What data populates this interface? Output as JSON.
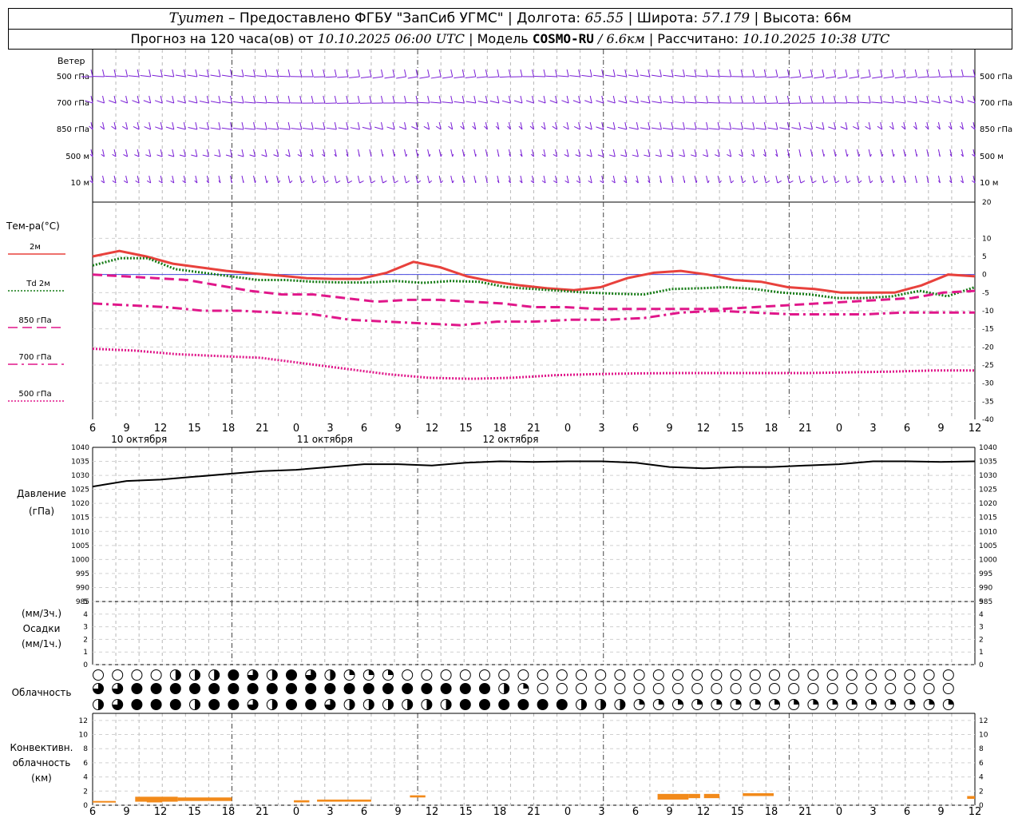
{
  "header": {
    "station": "Tyumen",
    "provided_by": "– Предоставлено ФГБУ \"ЗапСиб УГМС\" |",
    "lon_label": "Долгота:",
    "lon": "65.55",
    "lat_label": "| Широта:",
    "lat": "57.179",
    "alt_label": "| Высота:",
    "alt": "66м",
    "forecast_label": "Прогноз на 120 часа(ов) от",
    "forecast_start": "10.10.2025 06:00 UTC",
    "model_label": "| Модель",
    "model": "COSMO-RU",
    "resolution": "/ 6.6км",
    "computed_label": "| Рассчитано:",
    "computed": "10.10.2025 10:38 UTC"
  },
  "wind_panel": {
    "title": "Ветер",
    "levels": [
      "500 гПа",
      "700 гПа",
      "850 гПа",
      "500 м",
      "10 м"
    ],
    "color": "#7a1fd6"
  },
  "temp_panel": {
    "ylabel": "Тем-ра(°C)",
    "legend": [
      {
        "label": "2м",
        "color": "#e8413c",
        "style": "solid"
      },
      {
        "label": "Td  2м",
        "color": "#137a13",
        "style": "dotted"
      },
      {
        "label": "850 гПа",
        "color": "#e0178a",
        "style": "dash"
      },
      {
        "label": "700 гПа",
        "color": "#e0178a",
        "style": "dashdot"
      },
      {
        "label": "500 гПа",
        "color": "#e0178a",
        "style": "dotted"
      }
    ]
  },
  "pressure_panel": {
    "ylabel": [
      "Давление",
      "(гПа)"
    ]
  },
  "precip_panel": {
    "ylabel": [
      "(мм/3ч.)",
      "Осадки",
      "(мм/1ч.)"
    ]
  },
  "cloud_panel": {
    "ylabel": "Облачность"
  },
  "conv_panel": {
    "ylabel": [
      "Конвективн.",
      "облачность",
      "(км)"
    ]
  },
  "time_axis": {
    "ticks": [
      "6",
      "9",
      "12",
      "15",
      "18",
      "21",
      "0",
      "3",
      "6",
      "9",
      "12",
      "15",
      "18",
      "21",
      "0",
      "3",
      "6",
      "9",
      "12",
      "15",
      "18",
      "21",
      "0",
      "3",
      "6",
      "9",
      "12"
    ],
    "dates": [
      "10 октября",
      "11 октября",
      "12 октября"
    ]
  },
  "chart_data": [
    {
      "type": "line",
      "title": "Тем-ра(°C)",
      "x_hours": [
        0,
        3,
        6,
        9,
        12,
        15,
        18,
        21,
        24,
        27,
        30,
        33,
        36,
        39,
        42,
        45,
        48,
        51,
        54,
        57,
        60,
        63,
        66,
        69,
        72,
        75,
        78
      ],
      "ylim": [
        -40,
        20
      ],
      "yticks": [
        -40,
        -35,
        -30,
        -25,
        -20,
        -15,
        -10,
        -5,
        0,
        5,
        10
      ],
      "series": [
        {
          "name": "2м",
          "color": "#e8413c",
          "style": "solid",
          "values": [
            5,
            6.5,
            5,
            3,
            2,
            1,
            0.3,
            -0.3,
            -1,
            -1.2,
            -1.2,
            0.5,
            3.5,
            2,
            -0.5,
            -2,
            -3,
            -3.8,
            -4.3,
            -3.5,
            -1,
            0.5,
            1,
            0,
            -1.5,
            -2,
            -3.5,
            -4,
            -5,
            -5,
            -5,
            -3,
            0,
            -0.5
          ]
        },
        {
          "name": "Td 2м",
          "color": "#137a13",
          "style": "dotted",
          "values": [
            2.5,
            4.5,
            4.5,
            1.5,
            0.5,
            -0.5,
            -1.5,
            -1.5,
            -2,
            -2.2,
            -2.2,
            -1.8,
            -2.3,
            -1.8,
            -2,
            -3.5,
            -4,
            -4.5,
            -5,
            -5.3,
            -5.5,
            -4,
            -3.8,
            -3.5,
            -4,
            -5,
            -5.5,
            -6.5,
            -6.5,
            -6,
            -4.5,
            -6,
            -3.5
          ]
        },
        {
          "name": "850 гПа",
          "color": "#e0178a",
          "style": "dash",
          "values": [
            0,
            -0.5,
            -1,
            -1.5,
            -3,
            -4.5,
            -5.5,
            -5.5,
            -6.5,
            -7.5,
            -7,
            -7,
            -7.5,
            -8,
            -9,
            -9,
            -9.5,
            -9.5,
            -9.5,
            -9.5,
            -9.5,
            -9,
            -8.5,
            -8,
            -7.5,
            -7,
            -6.5,
            -5,
            -4.5
          ]
        },
        {
          "name": "700 гПа",
          "color": "#e0178a",
          "style": "dashdot",
          "values": [
            -8,
            -8.5,
            -9,
            -10,
            -10,
            -10.5,
            -11,
            -12.5,
            -13,
            -13.5,
            -14,
            -13,
            -13,
            -12.5,
            -12.5,
            -12,
            -10.5,
            -10,
            -10.5,
            -11,
            -11,
            -11,
            -10.5,
            -10.5,
            -10.5
          ]
        },
        {
          "name": "500 гПа",
          "color": "#e0178a",
          "style": "dotted",
          "values": [
            -20.5,
            -21,
            -22,
            -22.5,
            -23,
            -24.5,
            -26,
            -27.5,
            -28.5,
            -28.8,
            -28.5,
            -27.8,
            -27.5,
            -27.3,
            -27.2,
            -27.2,
            -27.2,
            -27.2,
            -27,
            -26.8,
            -26.5,
            -26.5
          ]
        }
      ]
    },
    {
      "type": "line",
      "title": "Давление (гПа)",
      "ylim": [
        985,
        1040
      ],
      "yticks": [
        985,
        990,
        995,
        1000,
        1005,
        1010,
        1015,
        1020,
        1025,
        1030,
        1035,
        1040
      ],
      "series": [
        {
          "name": "",
          "color": "#000000",
          "style": "solid",
          "values": [
            1026,
            1028,
            1028.5,
            1029.5,
            1030.5,
            1031.5,
            1032,
            1033,
            1034,
            1034,
            1033.5,
            1034.5,
            1035,
            1034.8,
            1035,
            1035,
            1034.5,
            1033,
            1032.5,
            1033,
            1033,
            1033.5,
            1034,
            1035,
            1035,
            1034.8,
            1035
          ]
        }
      ]
    },
    {
      "type": "bar",
      "title": "Осадки",
      "ylim": [
        0,
        5
      ],
      "yticks": [
        0,
        1,
        2,
        3,
        4,
        5
      ],
      "values": []
    },
    {
      "type": "heatmap",
      "title": "Облачность",
      "rows": 3,
      "cols": 45,
      "fraction_levels": "0=clear, 0.25, 0.5, 0.75, 1=overcast",
      "row_top": [
        0,
        0,
        0,
        0,
        0.5,
        0.5,
        0.5,
        1,
        0.75,
        0.5,
        1,
        0.75,
        0.5,
        0.25,
        0.25,
        0.25,
        0,
        0,
        0,
        0,
        0,
        0,
        0,
        0,
        0,
        0,
        0,
        0,
        0,
        0,
        0,
        0,
        0,
        0,
        0,
        0,
        0,
        0,
        0,
        0,
        0,
        0,
        0,
        0,
        0
      ],
      "row_mid": [
        0.75,
        0.75,
        1,
        1,
        1,
        1,
        1,
        1,
        1,
        1,
        1,
        1,
        1,
        1,
        1,
        1,
        1,
        1,
        1,
        1,
        1,
        0.5,
        0.25,
        0,
        0,
        0,
        0,
        0,
        0,
        0,
        0,
        0,
        0,
        0,
        0,
        0,
        0,
        0,
        0,
        0,
        0,
        0,
        0,
        0,
        0
      ],
      "row_bot": [
        0.5,
        0.75,
        1,
        1,
        1,
        0.5,
        1,
        1,
        0.75,
        0.5,
        1,
        1,
        0.75,
        0.5,
        0.5,
        0.5,
        0.5,
        0.5,
        0.5,
        1,
        1,
        1,
        1,
        1,
        1,
        0.5,
        0.5,
        0.5,
        0.25,
        0.25,
        0.25,
        0.25,
        0.25,
        0.25,
        0.25,
        0.25,
        0.25,
        0.25,
        0.25,
        0.25,
        0.25,
        0.25,
        0.25,
        0.25,
        0.25
      ]
    },
    {
      "type": "bar",
      "title": "Конвективн. облачность (км)",
      "ylim": [
        0,
        13
      ],
      "yticks": [
        0,
        2,
        4,
        6,
        8,
        10,
        12
      ],
      "color": "#f28a1a",
      "segments": [
        {
          "h0": 0,
          "h1": 3,
          "base": 0.4,
          "top": 0.6
        },
        {
          "h0": 5.5,
          "h1": 11,
          "base": 0.5,
          "top": 1.2
        },
        {
          "h0": 7,
          "h1": 9,
          "base": 0.4,
          "top": 1.1
        },
        {
          "h0": 11,
          "h1": 18,
          "base": 0.6,
          "top": 1.1
        },
        {
          "h0": 26,
          "h1": 28,
          "base": 0.4,
          "top": 0.7
        },
        {
          "h0": 29,
          "h1": 36,
          "base": 0.5,
          "top": 0.8
        },
        {
          "h0": 41,
          "h1": 43,
          "base": 1.1,
          "top": 1.4
        },
        {
          "h0": 73,
          "h1": 77,
          "base": 0.8,
          "top": 1.6
        },
        {
          "h0": 77,
          "h1": 78.5,
          "base": 1.0,
          "top": 1.6
        },
        {
          "h0": 79,
          "h1": 81,
          "base": 1.0,
          "top": 1.6
        },
        {
          "h0": 84,
          "h1": 88,
          "base": 1.3,
          "top": 1.7
        },
        {
          "h0": 113,
          "h1": 114,
          "base": 0.9,
          "top": 1.3
        }
      ]
    }
  ]
}
